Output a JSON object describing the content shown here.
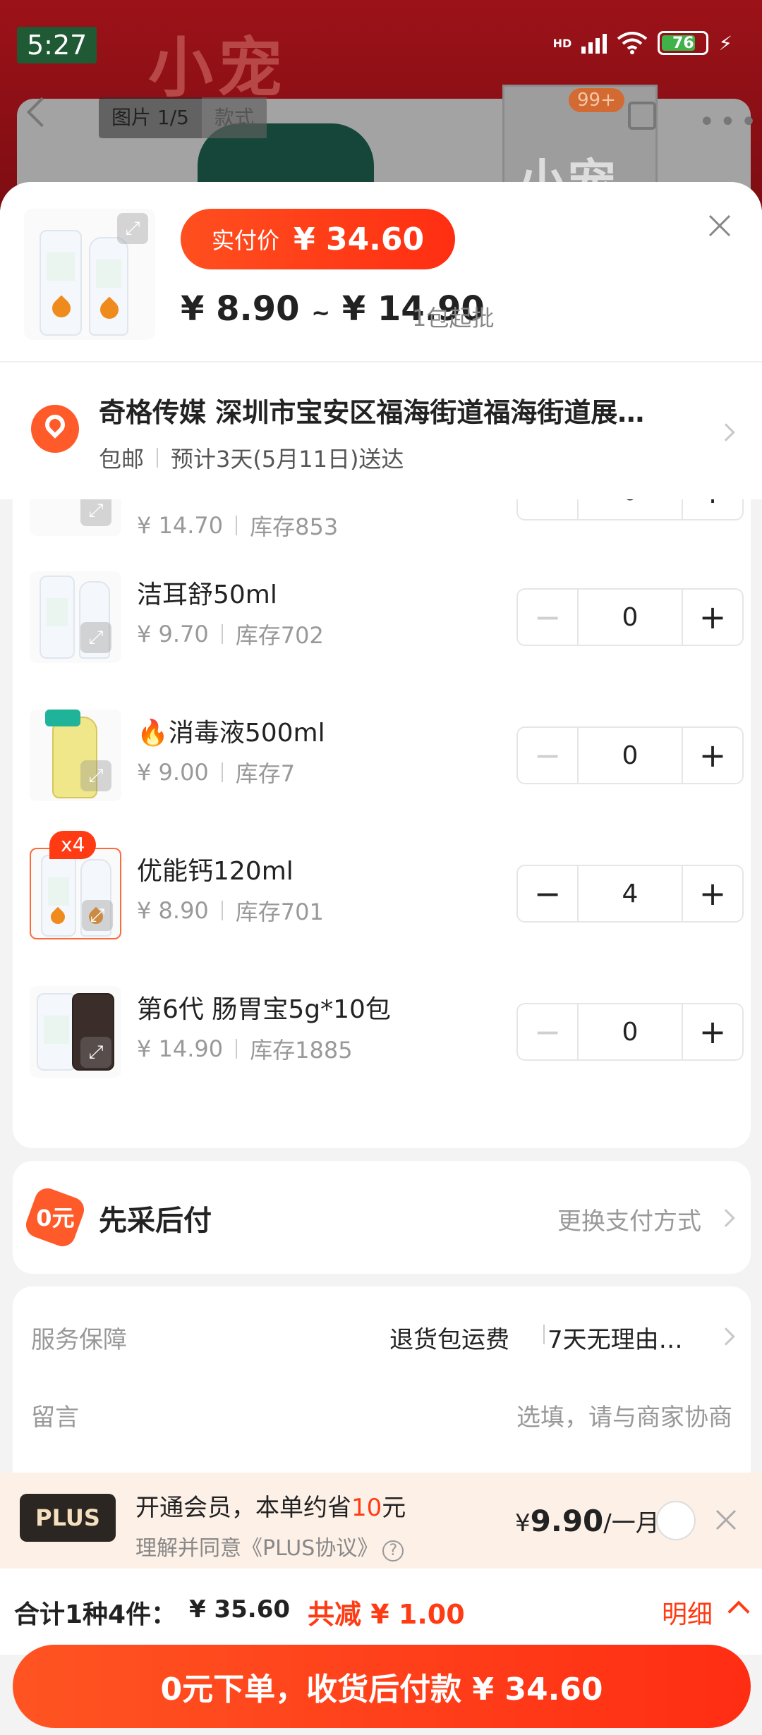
{
  "status_bar": {
    "time": "5:27",
    "network": "HD",
    "battery": "76"
  },
  "background_page": {
    "brand_text": "小宠",
    "image_tab": "图片 1/5",
    "style_tab": "款式",
    "cart_badge": "99+"
  },
  "header": {
    "paid_label": "实付价",
    "paid_price": "¥ 34.60",
    "price_min": "¥ 8.90",
    "price_sep": "~",
    "price_max": "¥ 14.90",
    "min_batch": "1包起批"
  },
  "address": {
    "title": "奇格传媒 深圳市宝安区福海街道福海街道展…",
    "shipping": "包邮",
    "eta": "预计3天(5月11日)送达"
  },
  "skus": [
    {
      "name": "",
      "price": "¥ 14.70",
      "stock": "库存853",
      "qty": "0",
      "selected": false
    },
    {
      "name": "洁耳舒50ml",
      "price": "¥ 9.70",
      "stock": "库存702",
      "qty": "0",
      "selected": false
    },
    {
      "name": "消毒液500ml",
      "price": "¥ 9.00",
      "stock": "库存7",
      "qty": "0",
      "selected": false,
      "hot": true
    },
    {
      "name": "优能钙120ml",
      "price": "¥ 8.90",
      "stock": "库存701",
      "qty": "4",
      "selected": true,
      "badge": "x4"
    },
    {
      "name": "第6代 肠胃宝5g*10包",
      "price": "¥ 14.90",
      "stock": "库存1885",
      "qty": "0",
      "selected": false
    }
  ],
  "payment": {
    "title": "先采后付",
    "change": "更换支付方式",
    "icon_text": "0元"
  },
  "service": {
    "label": "服务保障",
    "value1": "退货包运费",
    "value2": "7天无理由…",
    "message_label": "留言",
    "message_placeholder": "选填，请与商家协商"
  },
  "plus": {
    "logo": "PLUS",
    "title_prefix": "开通会员，本单约省",
    "title_amount": "10",
    "title_suffix": "元",
    "agree": "理解并同意《PLUS协议》",
    "price_currency": "¥",
    "price_value": "9.90",
    "price_period": "/一月"
  },
  "total": {
    "summary": "合计1种4件：",
    "amount": "¥ 35.60",
    "discount": "共减 ¥ 1.00",
    "detail": "明细"
  },
  "order_button": "0元下单，收货后付款 ¥ 34.60",
  "colors": {
    "accent": "#ff3b14",
    "primary_gradient_start": "#ff5422",
    "plus_bg": "#fdf0e7"
  }
}
